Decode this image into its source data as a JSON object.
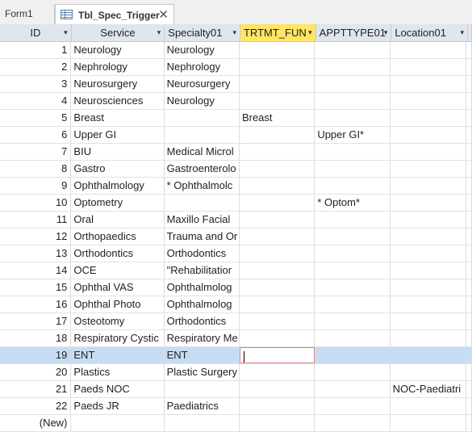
{
  "tabs": [
    {
      "label": "Form1",
      "active": false
    },
    {
      "label": "Tbl_Spec_Trigger",
      "active": true
    }
  ],
  "columns": [
    "ID",
    "Service",
    "Specialty01",
    "TRTMT_FUN",
    "APPTTYPE01",
    "Location01"
  ],
  "selected_column": "TRTMT_FUN",
  "rows": [
    {
      "id": "1",
      "service": "Neurology",
      "specialty": "Neurology",
      "trtmt": "",
      "appt": "",
      "location": ""
    },
    {
      "id": "2",
      "service": "Nephrology",
      "specialty": "Nephrology",
      "trtmt": "",
      "appt": "",
      "location": ""
    },
    {
      "id": "3",
      "service": "Neurosurgery",
      "specialty": "Neurosurgery",
      "trtmt": "",
      "appt": "",
      "location": ""
    },
    {
      "id": "4",
      "service": "Neurosciences",
      "specialty": "Neurology",
      "trtmt": "",
      "appt": "",
      "location": ""
    },
    {
      "id": "5",
      "service": "Breast",
      "specialty": "",
      "trtmt": "Breast",
      "appt": "",
      "location": ""
    },
    {
      "id": "6",
      "service": "Upper GI",
      "specialty": "",
      "trtmt": "",
      "appt": "Upper GI*",
      "location": ""
    },
    {
      "id": "7",
      "service": "BIU",
      "specialty": "Medical Microl",
      "trtmt": "",
      "appt": "",
      "location": ""
    },
    {
      "id": "8",
      "service": "Gastro",
      "specialty": "Gastroenterolo",
      "trtmt": "",
      "appt": "",
      "location": ""
    },
    {
      "id": "9",
      "service": "Ophthalmology",
      "specialty": "* Ophthalmolc",
      "trtmt": "",
      "appt": "",
      "location": ""
    },
    {
      "id": "10",
      "service": "Optometry",
      "specialty": "",
      "trtmt": "",
      "appt": "* Optom*",
      "location": ""
    },
    {
      "id": "11",
      "service": "Oral",
      "specialty": "Maxillo Facial",
      "trtmt": "",
      "appt": "",
      "location": ""
    },
    {
      "id": "12",
      "service": "Orthopaedics",
      "specialty": "Trauma and Or",
      "trtmt": "",
      "appt": "",
      "location": ""
    },
    {
      "id": "13",
      "service": "Orthodontics",
      "specialty": "Orthodontics",
      "trtmt": "",
      "appt": "",
      "location": ""
    },
    {
      "id": "14",
      "service": "OCE",
      "specialty": "\"Rehabilitatior",
      "trtmt": "",
      "appt": "",
      "location": ""
    },
    {
      "id": "15",
      "service": "Ophthal VAS",
      "specialty": "Ophthalmolog",
      "trtmt": "",
      "appt": "",
      "location": ""
    },
    {
      "id": "16",
      "service": "Ophthal Photo",
      "specialty": "Ophthalmolog",
      "trtmt": "",
      "appt": "",
      "location": ""
    },
    {
      "id": "17",
      "service": "Osteotomy",
      "specialty": "Orthodontics",
      "trtmt": "",
      "appt": "",
      "location": ""
    },
    {
      "id": "18",
      "service": "Respiratory Cystic",
      "specialty": "Respiratory Me",
      "trtmt": "",
      "appt": "",
      "location": ""
    },
    {
      "id": "19",
      "service": "ENT",
      "specialty": "ENT",
      "trtmt": "",
      "appt": "",
      "location": "",
      "current": true
    },
    {
      "id": "20",
      "service": "Plastics",
      "specialty": "Plastic Surgery",
      "trtmt": "",
      "appt": "",
      "location": ""
    },
    {
      "id": "21",
      "service": "Paeds NOC",
      "specialty": "",
      "trtmt": "",
      "appt": "",
      "location": "NOC-Paediatri"
    },
    {
      "id": "22",
      "service": "Paeds JR",
      "specialty": "Paediatrics",
      "trtmt": "",
      "appt": "",
      "location": ""
    }
  ],
  "new_row_label": "(New)",
  "colors": {
    "header_bg": "#dfe6ee",
    "selected_header": "#ffe466",
    "current_row": "#c5ddf4",
    "edit_border": "#e08080"
  }
}
